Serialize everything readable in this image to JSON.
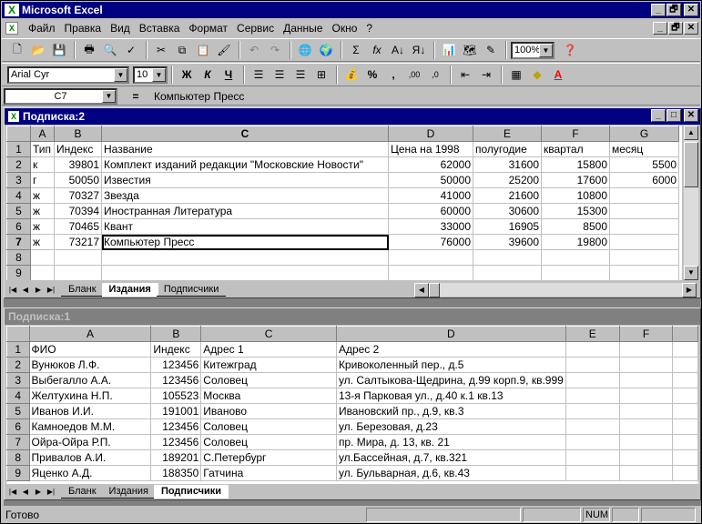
{
  "app": {
    "title": "Microsoft Excel",
    "window_buttons": [
      "_",
      "🗗",
      "✕"
    ]
  },
  "menu": [
    "Файл",
    "Правка",
    "Вид",
    "Вставка",
    "Формат",
    "Сервис",
    "Данные",
    "Окно",
    "?"
  ],
  "toolbar": {
    "zoom": "100%",
    "font_name": "Arial Cyr",
    "font_size": "10",
    "bold": "Ж",
    "italic": "К",
    "underline": "Ч",
    "percent": "%",
    "comma": ",",
    "inc_decimal": ",00",
    "dec_decimal": ",0"
  },
  "formula_bar": {
    "cell_ref": "C7",
    "eq": "=",
    "value": "Компьютер Пресс"
  },
  "window1": {
    "title": "Подписка:2",
    "columns": [
      "A",
      "B",
      "C",
      "D",
      "E",
      "F",
      "G"
    ],
    "rows": [
      {
        "n": "1",
        "cells": [
          "Тип",
          "Индекс",
          "Название",
          "Цена на 1998",
          "полугодие",
          "квартал",
          "месяц"
        ]
      },
      {
        "n": "2",
        "cells": [
          "к",
          "39801",
          "Комплект изданий редакции \"Московские Новости\"",
          "62000",
          "31600",
          "15800",
          "5500"
        ]
      },
      {
        "n": "3",
        "cells": [
          "г",
          "50050",
          "Известия",
          "50000",
          "25200",
          "17600",
          "6000"
        ]
      },
      {
        "n": "4",
        "cells": [
          "ж",
          "70327",
          "Звезда",
          "41000",
          "21600",
          "10800",
          ""
        ]
      },
      {
        "n": "5",
        "cells": [
          "ж",
          "70394",
          "Иностранная Литература",
          "60000",
          "30600",
          "15300",
          ""
        ]
      },
      {
        "n": "6",
        "cells": [
          "ж",
          "70465",
          "Квант",
          "33000",
          "16905",
          "8500",
          ""
        ]
      },
      {
        "n": "7",
        "cells": [
          "ж",
          "73217",
          "Компьютер Пресс",
          "76000",
          "39600",
          "19800",
          ""
        ]
      },
      {
        "n": "8",
        "cells": [
          "",
          "",
          "",
          "",
          "",
          "",
          ""
        ]
      },
      {
        "n": "9",
        "cells": [
          "",
          "",
          "",
          "",
          "",
          "",
          ""
        ]
      }
    ],
    "tabs": [
      "Бланк",
      "Издания",
      "Подписчики"
    ],
    "active_tab": "Издания"
  },
  "window2": {
    "title": "Подписка:1",
    "columns": [
      "A",
      "B",
      "C",
      "D",
      "E",
      "F"
    ],
    "rows": [
      {
        "n": "1",
        "cells": [
          "ФИО",
          "Индекс",
          "Адрес 1",
          "Адрес 2",
          "",
          ""
        ]
      },
      {
        "n": "2",
        "cells": [
          "Вунюков Л.Ф.",
          "123456",
          "Китежград",
          "Кривоколенный пер., д.5",
          "",
          ""
        ]
      },
      {
        "n": "3",
        "cells": [
          "Выбегалло А.А.",
          "123456",
          "Соловец",
          "ул. Салтыкова-Щедрина, д.99 корп.9, кв.999",
          "",
          ""
        ]
      },
      {
        "n": "4",
        "cells": [
          "Желтухина Н.П.",
          "105523",
          "Москва",
          "13-я Парковая ул., д.40 к.1 кв.13",
          "",
          ""
        ]
      },
      {
        "n": "5",
        "cells": [
          "Иванов И.И.",
          "191001",
          "Иваново",
          "Ивановский пр., д.9, кв.3",
          "",
          ""
        ]
      },
      {
        "n": "6",
        "cells": [
          "Камноедов М.М.",
          "123456",
          "Соловец",
          "ул. Березовая, д.23",
          "",
          ""
        ]
      },
      {
        "n": "7",
        "cells": [
          "Ойра-Ойра Р.П.",
          "123456",
          "Соловец",
          "пр. Мира, д. 13, кв. 21",
          "",
          ""
        ]
      },
      {
        "n": "8",
        "cells": [
          "Привалов А.И.",
          "189201",
          "С.Петербург",
          "ул.Бассейная, д.7, кв.321",
          "",
          ""
        ]
      },
      {
        "n": "9",
        "cells": [
          "Яценко А.Д.",
          "188350",
          "Гатчина",
          "ул. Бульварная, д.6, кв.43",
          "",
          ""
        ]
      }
    ],
    "tabs": [
      "Бланк",
      "Издания",
      "Подписчики"
    ],
    "active_tab": "Подписчики"
  },
  "status": {
    "text": "Готово",
    "num": "NUM"
  }
}
